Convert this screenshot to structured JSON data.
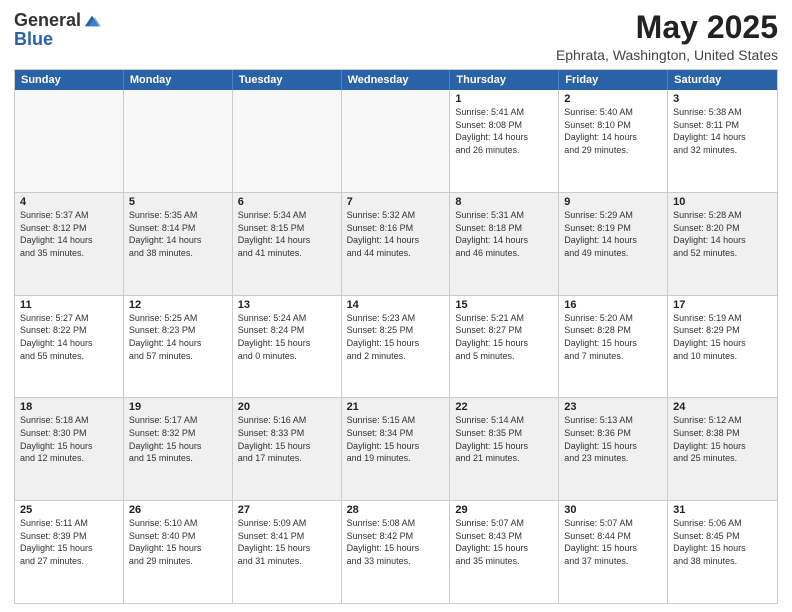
{
  "header": {
    "logo_general": "General",
    "logo_blue": "Blue",
    "title": "May 2025",
    "subtitle": "Ephrata, Washington, United States"
  },
  "calendar": {
    "days_of_week": [
      "Sunday",
      "Monday",
      "Tuesday",
      "Wednesday",
      "Thursday",
      "Friday",
      "Saturday"
    ],
    "rows": [
      [
        {
          "day": "",
          "info": ""
        },
        {
          "day": "",
          "info": ""
        },
        {
          "day": "",
          "info": ""
        },
        {
          "day": "",
          "info": ""
        },
        {
          "day": "1",
          "info": "Sunrise: 5:41 AM\nSunset: 8:08 PM\nDaylight: 14 hours\nand 26 minutes."
        },
        {
          "day": "2",
          "info": "Sunrise: 5:40 AM\nSunset: 8:10 PM\nDaylight: 14 hours\nand 29 minutes."
        },
        {
          "day": "3",
          "info": "Sunrise: 5:38 AM\nSunset: 8:11 PM\nDaylight: 14 hours\nand 32 minutes."
        }
      ],
      [
        {
          "day": "4",
          "info": "Sunrise: 5:37 AM\nSunset: 8:12 PM\nDaylight: 14 hours\nand 35 minutes."
        },
        {
          "day": "5",
          "info": "Sunrise: 5:35 AM\nSunset: 8:14 PM\nDaylight: 14 hours\nand 38 minutes."
        },
        {
          "day": "6",
          "info": "Sunrise: 5:34 AM\nSunset: 8:15 PM\nDaylight: 14 hours\nand 41 minutes."
        },
        {
          "day": "7",
          "info": "Sunrise: 5:32 AM\nSunset: 8:16 PM\nDaylight: 14 hours\nand 44 minutes."
        },
        {
          "day": "8",
          "info": "Sunrise: 5:31 AM\nSunset: 8:18 PM\nDaylight: 14 hours\nand 46 minutes."
        },
        {
          "day": "9",
          "info": "Sunrise: 5:29 AM\nSunset: 8:19 PM\nDaylight: 14 hours\nand 49 minutes."
        },
        {
          "day": "10",
          "info": "Sunrise: 5:28 AM\nSunset: 8:20 PM\nDaylight: 14 hours\nand 52 minutes."
        }
      ],
      [
        {
          "day": "11",
          "info": "Sunrise: 5:27 AM\nSunset: 8:22 PM\nDaylight: 14 hours\nand 55 minutes."
        },
        {
          "day": "12",
          "info": "Sunrise: 5:25 AM\nSunset: 8:23 PM\nDaylight: 14 hours\nand 57 minutes."
        },
        {
          "day": "13",
          "info": "Sunrise: 5:24 AM\nSunset: 8:24 PM\nDaylight: 15 hours\nand 0 minutes."
        },
        {
          "day": "14",
          "info": "Sunrise: 5:23 AM\nSunset: 8:25 PM\nDaylight: 15 hours\nand 2 minutes."
        },
        {
          "day": "15",
          "info": "Sunrise: 5:21 AM\nSunset: 8:27 PM\nDaylight: 15 hours\nand 5 minutes."
        },
        {
          "day": "16",
          "info": "Sunrise: 5:20 AM\nSunset: 8:28 PM\nDaylight: 15 hours\nand 7 minutes."
        },
        {
          "day": "17",
          "info": "Sunrise: 5:19 AM\nSunset: 8:29 PM\nDaylight: 15 hours\nand 10 minutes."
        }
      ],
      [
        {
          "day": "18",
          "info": "Sunrise: 5:18 AM\nSunset: 8:30 PM\nDaylight: 15 hours\nand 12 minutes."
        },
        {
          "day": "19",
          "info": "Sunrise: 5:17 AM\nSunset: 8:32 PM\nDaylight: 15 hours\nand 15 minutes."
        },
        {
          "day": "20",
          "info": "Sunrise: 5:16 AM\nSunset: 8:33 PM\nDaylight: 15 hours\nand 17 minutes."
        },
        {
          "day": "21",
          "info": "Sunrise: 5:15 AM\nSunset: 8:34 PM\nDaylight: 15 hours\nand 19 minutes."
        },
        {
          "day": "22",
          "info": "Sunrise: 5:14 AM\nSunset: 8:35 PM\nDaylight: 15 hours\nand 21 minutes."
        },
        {
          "day": "23",
          "info": "Sunrise: 5:13 AM\nSunset: 8:36 PM\nDaylight: 15 hours\nand 23 minutes."
        },
        {
          "day": "24",
          "info": "Sunrise: 5:12 AM\nSunset: 8:38 PM\nDaylight: 15 hours\nand 25 minutes."
        }
      ],
      [
        {
          "day": "25",
          "info": "Sunrise: 5:11 AM\nSunset: 8:39 PM\nDaylight: 15 hours\nand 27 minutes."
        },
        {
          "day": "26",
          "info": "Sunrise: 5:10 AM\nSunset: 8:40 PM\nDaylight: 15 hours\nand 29 minutes."
        },
        {
          "day": "27",
          "info": "Sunrise: 5:09 AM\nSunset: 8:41 PM\nDaylight: 15 hours\nand 31 minutes."
        },
        {
          "day": "28",
          "info": "Sunrise: 5:08 AM\nSunset: 8:42 PM\nDaylight: 15 hours\nand 33 minutes."
        },
        {
          "day": "29",
          "info": "Sunrise: 5:07 AM\nSunset: 8:43 PM\nDaylight: 15 hours\nand 35 minutes."
        },
        {
          "day": "30",
          "info": "Sunrise: 5:07 AM\nSunset: 8:44 PM\nDaylight: 15 hours\nand 37 minutes."
        },
        {
          "day": "31",
          "info": "Sunrise: 5:06 AM\nSunset: 8:45 PM\nDaylight: 15 hours\nand 38 minutes."
        }
      ]
    ]
  }
}
